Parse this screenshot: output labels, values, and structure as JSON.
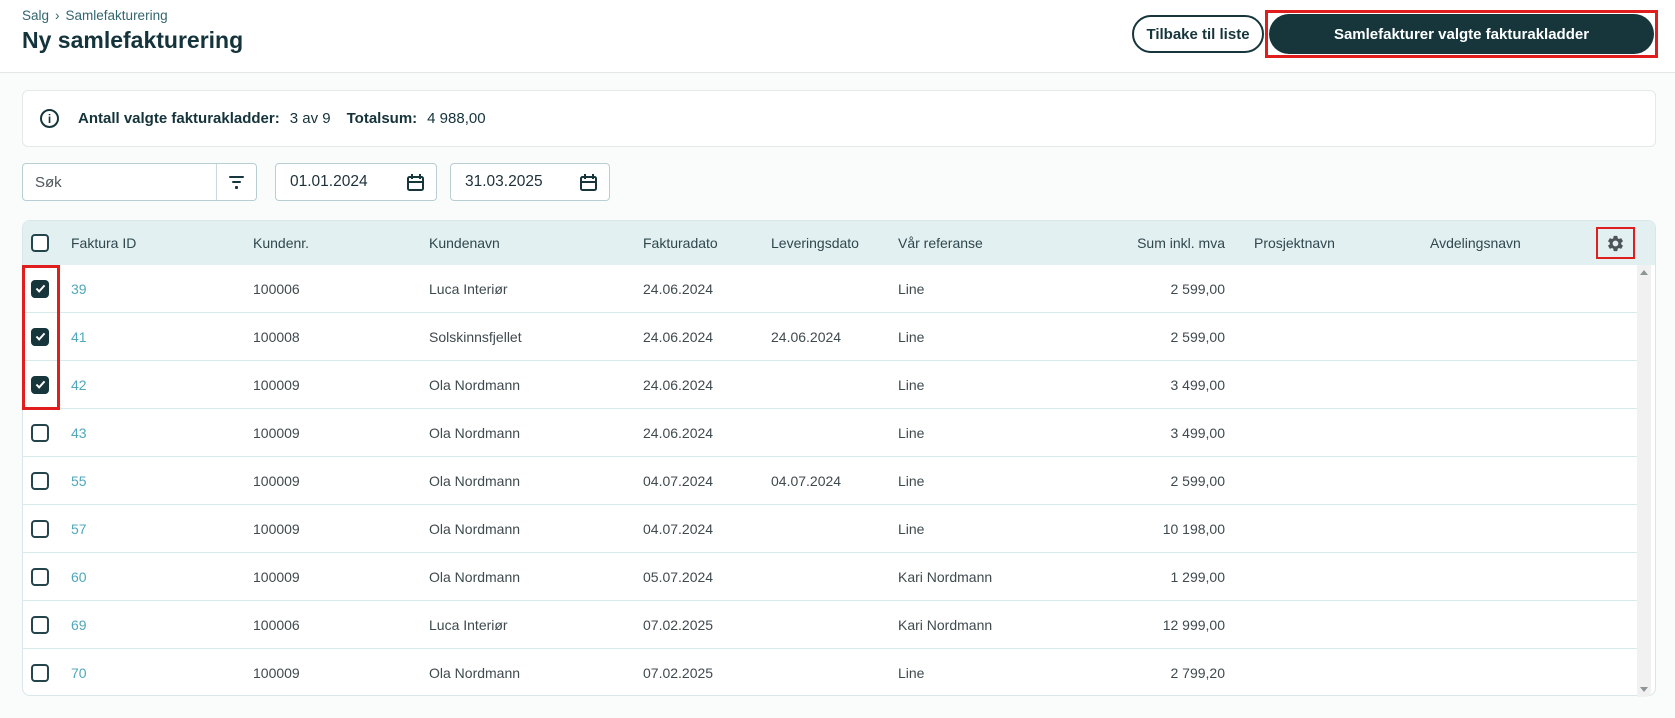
{
  "breadcrumb": {
    "parent": "Salg",
    "separator": "›",
    "current": "Samlefakturering"
  },
  "page_title": "Ny samlefakturering",
  "actions": {
    "back_button": "Tilbake til liste",
    "primary_button": "Samlefakturer valgte fakturakladder"
  },
  "info_bar": {
    "count_label": "Antall valgte fakturakladder:",
    "count_value": "3 av 9",
    "total_label": "Totalsum:",
    "total_value": "4 988,00"
  },
  "filters": {
    "search_placeholder": "Søk",
    "date_from": "01.01.2024",
    "date_to": "31.03.2025"
  },
  "table": {
    "columns": [
      "Faktura ID",
      "Kundenr.",
      "Kundenavn",
      "Fakturadato",
      "Leveringsdato",
      "Vår referanse",
      "Sum inkl. mva",
      "Prosjektnavn",
      "Avdelingsnavn"
    ],
    "rows": [
      {
        "checked": true,
        "faktura_id": "39",
        "kundenr": "100006",
        "kundenavn": "Luca Interiør",
        "fakturadato": "24.06.2024",
        "leveringsdato": "",
        "var_referanse": "Line",
        "sum_inkl_mva": "2 599,00",
        "prosjektnavn": "",
        "avdelingsnavn": ""
      },
      {
        "checked": true,
        "faktura_id": "41",
        "kundenr": "100008",
        "kundenavn": "Solskinnsfjellet",
        "fakturadato": "24.06.2024",
        "leveringsdato": "24.06.2024",
        "var_referanse": "Line",
        "sum_inkl_mva": "2 599,00",
        "prosjektnavn": "",
        "avdelingsnavn": ""
      },
      {
        "checked": true,
        "faktura_id": "42",
        "kundenr": "100009",
        "kundenavn": "Ola Nordmann",
        "fakturadato": "24.06.2024",
        "leveringsdato": "",
        "var_referanse": "Line",
        "sum_inkl_mva": "3 499,00",
        "prosjektnavn": "",
        "avdelingsnavn": ""
      },
      {
        "checked": false,
        "faktura_id": "43",
        "kundenr": "100009",
        "kundenavn": "Ola Nordmann",
        "fakturadato": "24.06.2024",
        "leveringsdato": "",
        "var_referanse": "Line",
        "sum_inkl_mva": "3 499,00",
        "prosjektnavn": "",
        "avdelingsnavn": ""
      },
      {
        "checked": false,
        "faktura_id": "55",
        "kundenr": "100009",
        "kundenavn": "Ola Nordmann",
        "fakturadato": "04.07.2024",
        "leveringsdato": "04.07.2024",
        "var_referanse": "Line",
        "sum_inkl_mva": "2 599,00",
        "prosjektnavn": "",
        "avdelingsnavn": ""
      },
      {
        "checked": false,
        "faktura_id": "57",
        "kundenr": "100009",
        "kundenavn": "Ola Nordmann",
        "fakturadato": "04.07.2024",
        "leveringsdato": "",
        "var_referanse": "Line",
        "sum_inkl_mva": "10 198,00",
        "prosjektnavn": "",
        "avdelingsnavn": ""
      },
      {
        "checked": false,
        "faktura_id": "60",
        "kundenr": "100009",
        "kundenavn": "Ola Nordmann",
        "fakturadato": "05.07.2024",
        "leveringsdato": "",
        "var_referanse": "Kari Nordmann",
        "sum_inkl_mva": "1 299,00",
        "prosjektnavn": "",
        "avdelingsnavn": ""
      },
      {
        "checked": false,
        "faktura_id": "69",
        "kundenr": "100006",
        "kundenavn": "Luca Interiør",
        "fakturadato": "07.02.2025",
        "leveringsdato": "",
        "var_referanse": "Kari Nordmann",
        "sum_inkl_mva": "12 999,00",
        "prosjektnavn": "",
        "avdelingsnavn": ""
      },
      {
        "checked": false,
        "faktura_id": "70",
        "kundenr": "100009",
        "kundenavn": "Ola Nordmann",
        "fakturadato": "07.02.2025",
        "leveringsdato": "",
        "var_referanse": "Line",
        "sum_inkl_mva": "2 799,20",
        "prosjektnavn": "",
        "avdelingsnavn": ""
      }
    ]
  },
  "colors": {
    "primary_dark": "#16363C",
    "link": "#4FA7BC",
    "table_header_bg": "#E2F0F2",
    "annotation_red": "#E01E1E"
  }
}
